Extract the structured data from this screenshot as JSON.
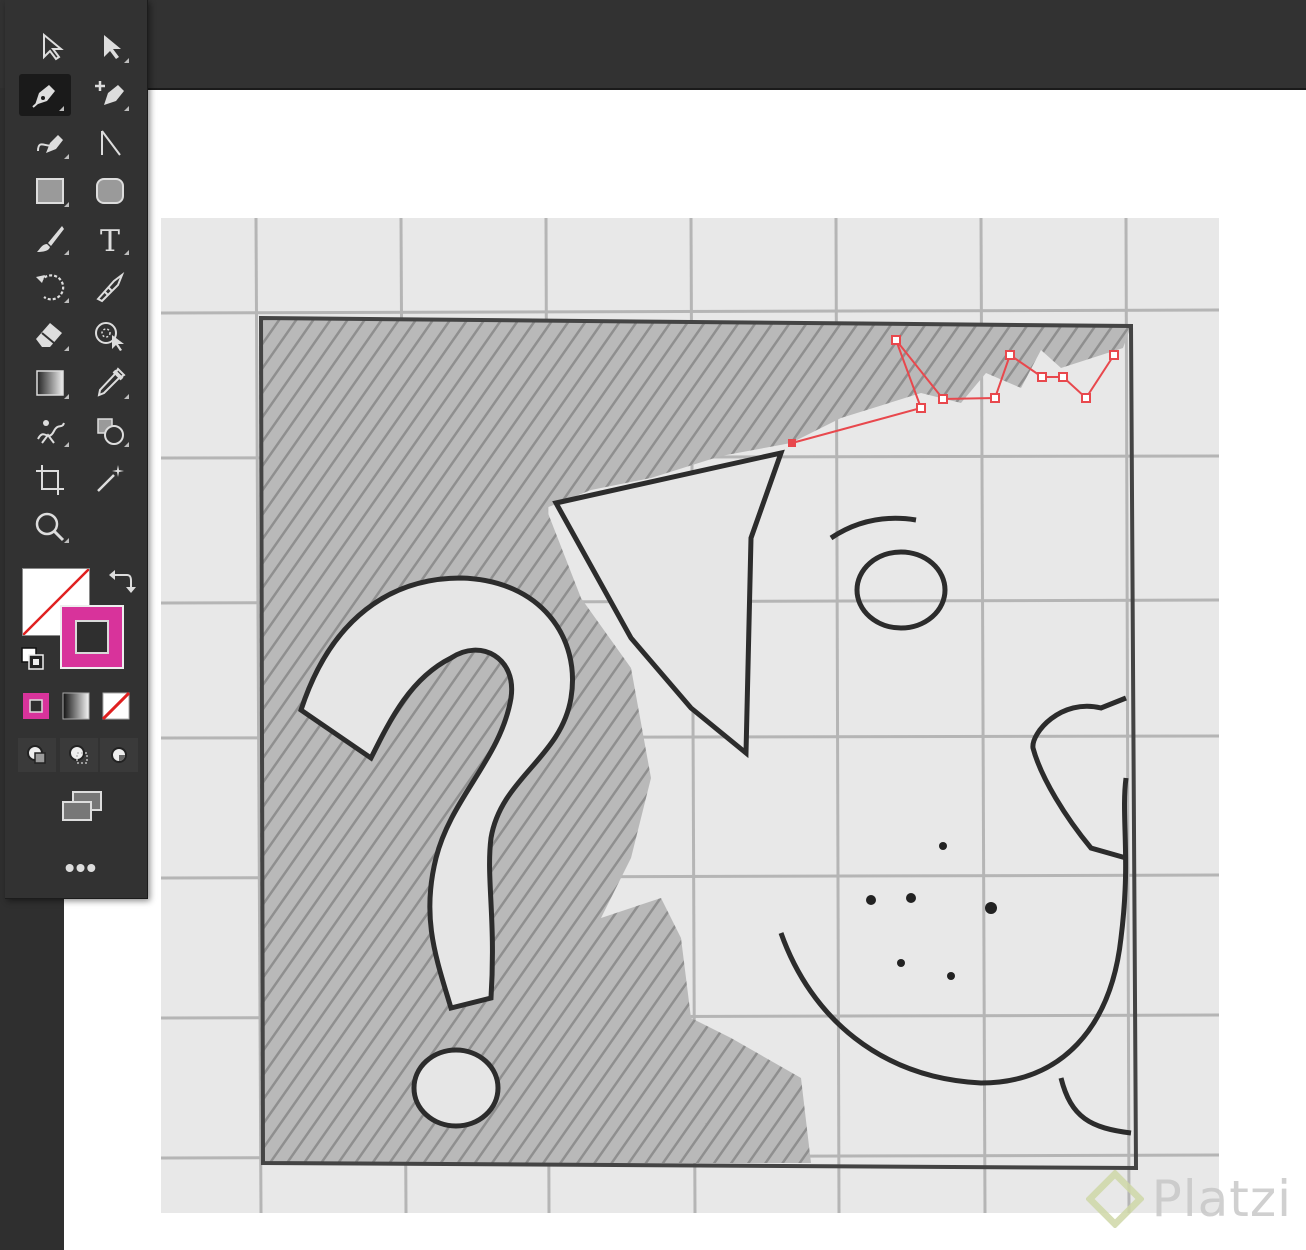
{
  "app": {
    "toolbar": {
      "tools": [
        {
          "id": "selection",
          "icon": "selection-arrow-icon"
        },
        {
          "id": "direct-selection",
          "icon": "direct-selection-arrow-icon"
        },
        {
          "id": "pen",
          "icon": "pen-tool-icon",
          "active": true
        },
        {
          "id": "add-anchor",
          "icon": "add-anchor-point-icon"
        },
        {
          "id": "curvature",
          "icon": "curvature-tool-icon"
        },
        {
          "id": "line-segment",
          "icon": "line-segment-icon"
        },
        {
          "id": "rectangle",
          "icon": "rectangle-icon"
        },
        {
          "id": "rounded-rectangle",
          "icon": "rounded-rectangle-icon"
        },
        {
          "id": "paintbrush",
          "icon": "paintbrush-icon"
        },
        {
          "id": "type",
          "icon": "type-tool-icon"
        },
        {
          "id": "rotate",
          "icon": "rotate-icon"
        },
        {
          "id": "width",
          "icon": "width-tool-icon"
        },
        {
          "id": "eraser",
          "icon": "eraser-icon"
        },
        {
          "id": "shape-builder",
          "icon": "shape-builder-icon"
        },
        {
          "id": "gradient",
          "icon": "gradient-icon"
        },
        {
          "id": "eyedropper",
          "icon": "eyedropper-icon"
        },
        {
          "id": "puppet-warp",
          "icon": "puppet-warp-icon"
        },
        {
          "id": "live-paint",
          "icon": "live-paint-bucket-icon"
        },
        {
          "id": "artboard",
          "icon": "artboard-tool-icon"
        },
        {
          "id": "magic-wand",
          "icon": "magic-wand-icon"
        },
        {
          "id": "zoom",
          "icon": "zoom-icon"
        }
      ],
      "more_label": "•••",
      "fill_color": "#ffffff",
      "stroke_color": "#d8339b",
      "accent_path_color": "#e8484d"
    },
    "watermark": {
      "text": "Platzi"
    }
  }
}
